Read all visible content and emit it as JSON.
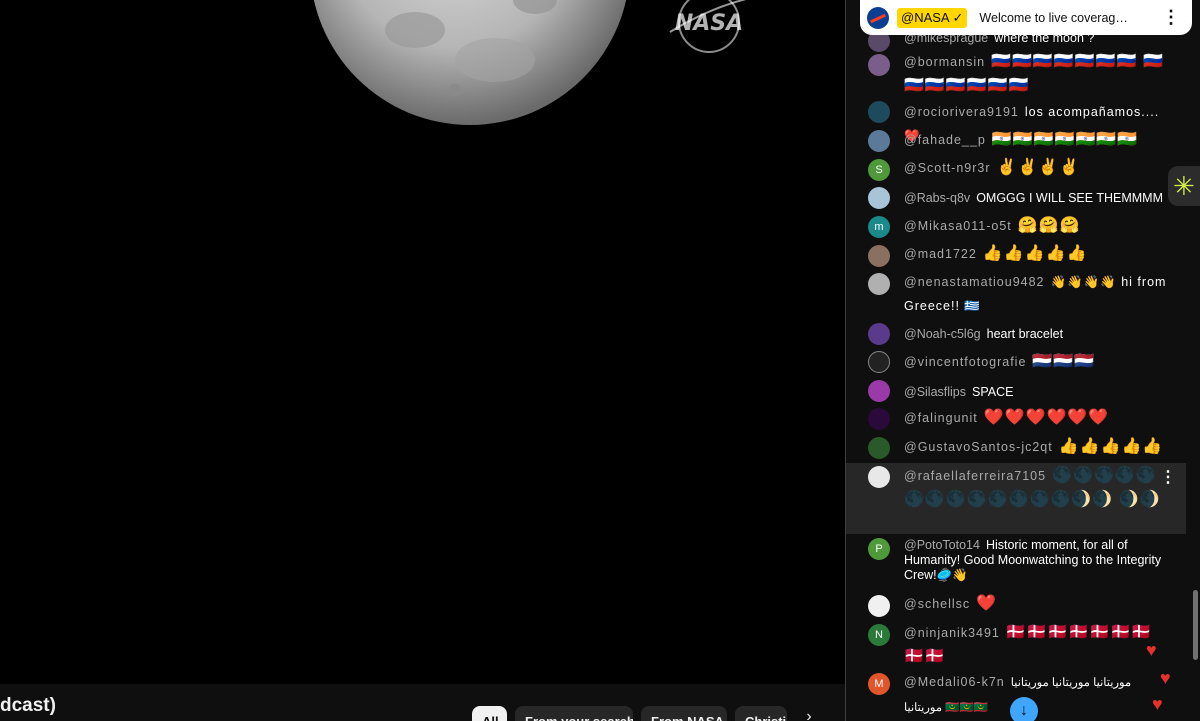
{
  "video": {
    "title_fragment": "dcast)"
  },
  "filters": {
    "chips": [
      "All",
      "From your search",
      "From NASA",
      "Christi"
    ]
  },
  "chat": {
    "pinned": {
      "author": "@NASA",
      "text": "Welcome to live coverag…"
    },
    "messages": [
      {
        "author": "@mikesprague",
        "text": "where the moon ?"
      },
      {
        "author": "@bormansin",
        "text": "🇷🇺🇷🇺🇷🇺🇷🇺🇷🇺🇷🇺🇷🇺 🇷🇺🇷🇺🇷🇺🇷🇺🇷🇺🇷🇺🇷🇺"
      },
      {
        "author": "@rociorivera9191",
        "text": "los acompañamos.... ❤️"
      },
      {
        "author": "@fahade__p",
        "text": "🇮🇳🇮🇳🇮🇳🇮🇳🇮🇳🇮🇳🇮🇳"
      },
      {
        "author": "@Scott-n9r3r",
        "text": "✌️✌️✌️✌️"
      },
      {
        "author": "@Rabs-q8v",
        "text": "OMGGG I WILL SEE THEMMMM"
      },
      {
        "author": "@Mikasa011-o5t",
        "text": "🤗🤗🤗"
      },
      {
        "author": "@mad1722",
        "text": "👍👍👍👍👍"
      },
      {
        "author": "@nenastamatiou9482",
        "text": "👋👋👋👋 hi from Greece!! 🇬🇷"
      },
      {
        "author": "@Noah-c5l6g",
        "text": "heart bracelet"
      },
      {
        "author": "@vincentfotografie",
        "text": "🇳🇱🇳🇱🇳🇱"
      },
      {
        "author": "@Silasflips",
        "text": "SPACE"
      },
      {
        "author": "@falingunit",
        "text": "❤️❤️❤️❤️❤️❤️"
      },
      {
        "author": "@GustavoSantos-jc2qt",
        "text": "👍👍👍👍👍"
      },
      {
        "author": "@rafaellaferreira7105",
        "text": "🌑🌑🌑🌑🌑 🌑🌑🌑🌑🌑🌑🌑🌑🌒🌒 🌒🌒"
      },
      {
        "author": "@PotoToto14",
        "text": "Historic moment, for all of Humanity! Good Moonwatching to the Integrity Crew!🥏👋"
      },
      {
        "author": "@schellsc",
        "text": "❤️"
      },
      {
        "author": "@ninjanik3491",
        "text": "🇩🇰🇩🇰🇩🇰🇩🇰🇩🇰🇩🇰🇩🇰 🇩🇰🇩🇰"
      },
      {
        "author": "@Medali06-k7n",
        "text": "موريتانيا موريتانيا موريتانيا موريتانيا 🇲🇷🇲🇷🇲🇷"
      }
    ],
    "avatar_letters": {
      "scott": "S",
      "mikasa": "m",
      "potototo": "P",
      "ninjanik": "N",
      "medali": "M"
    }
  },
  "colors": {
    "highlight_author": "#ffd600",
    "accent_blue": "#3ea6ff",
    "heart": "#e5322d",
    "chat_bg": "#0f0f0f",
    "author_grey": "#aaaaaa"
  },
  "icons": {
    "pinned_menu": "more-vert-icon",
    "scroll_down": "arrow-down-icon",
    "side": "sparkle-icon",
    "chip_next": "chevron-right-icon"
  }
}
